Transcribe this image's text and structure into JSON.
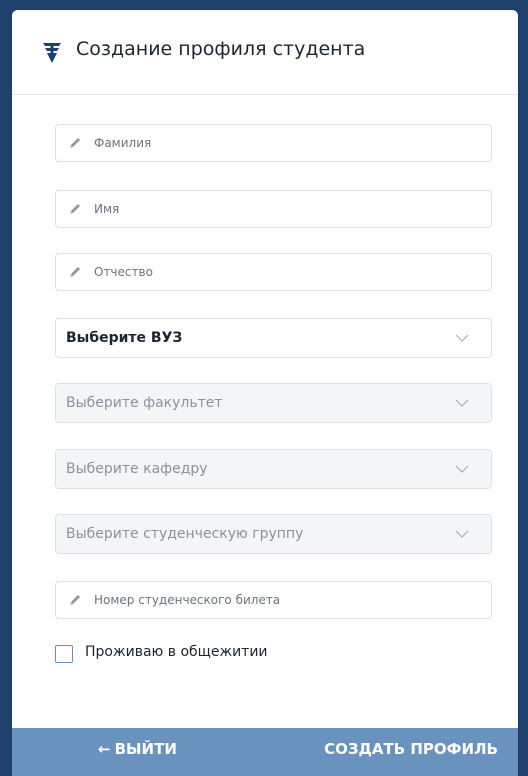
{
  "header": {
    "title": "Создание профиля студента",
    "logo_icon": "shield-logo-icon"
  },
  "form": {
    "last_name": {
      "placeholder": "Фамилия",
      "value": ""
    },
    "first_name": {
      "placeholder": "Имя",
      "value": ""
    },
    "middle_name": {
      "placeholder": "Отчество",
      "value": ""
    },
    "university": {
      "label": "Выберите ВУЗ",
      "enabled": true
    },
    "faculty": {
      "label": "Выберите факультет",
      "enabled": false
    },
    "department": {
      "label": "Выберите кафедру",
      "enabled": false
    },
    "group": {
      "label": "Выберите студенческую группу",
      "enabled": false
    },
    "student_id": {
      "placeholder": "Номер студенческого билета",
      "value": ""
    },
    "dormitory": {
      "label": "Проживаю в общежитии",
      "checked": false
    }
  },
  "footer": {
    "exit_label": "ВЫЙТИ",
    "create_label": "СОЗДАТЬ ПРОФИЛЬ"
  },
  "colors": {
    "frame": "#1f3f6d",
    "footer": "#6a92bf",
    "accent": "#6b8db8"
  }
}
